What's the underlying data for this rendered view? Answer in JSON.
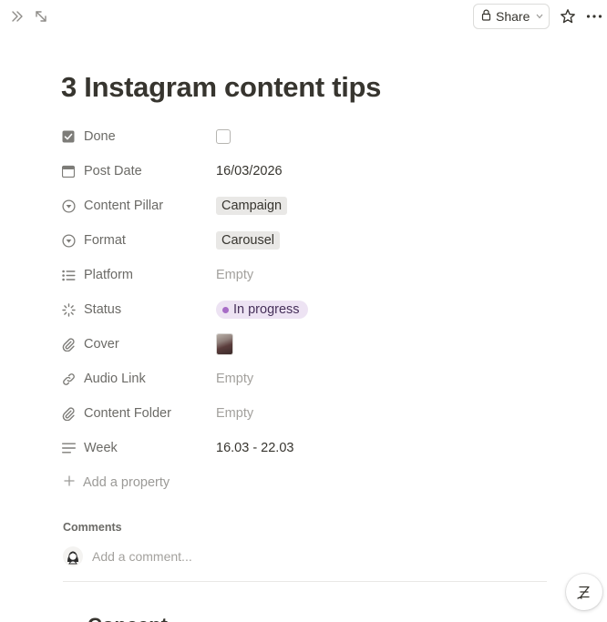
{
  "toolbar": {
    "share_label": "Share"
  },
  "page": {
    "title": "3 Instagram content tips"
  },
  "properties": [
    {
      "name": "Done",
      "icon": "checkbox-icon",
      "value_type": "checkbox",
      "checked": false
    },
    {
      "name": "Post Date",
      "icon": "calendar-icon",
      "value": "16/03/2026"
    },
    {
      "name": "Content Pillar",
      "icon": "select-icon",
      "value": "Campaign"
    },
    {
      "name": "Format",
      "icon": "select-icon",
      "value": "Carousel"
    },
    {
      "name": "Platform",
      "icon": "multi-select-icon",
      "value": "Empty"
    },
    {
      "name": "Status",
      "icon": "status-icon",
      "value": "In progress"
    },
    {
      "name": "Cover",
      "icon": "file-link-icon",
      "value_type": "image"
    },
    {
      "name": "Audio Link",
      "icon": "url-link-icon",
      "value": "Empty"
    },
    {
      "name": "Content Folder",
      "icon": "file-link-icon",
      "value": "Empty"
    },
    {
      "name": "Week",
      "icon": "text-icon",
      "value": "16.03 - 22.03"
    }
  ],
  "add_property_label": "Add a property",
  "comments": {
    "label": "Comments",
    "placeholder": "Add a comment..."
  },
  "next_heading": "Concept",
  "colors": {
    "status_bg": "#ede3f3",
    "status_dot": "#a76cc6",
    "tag_bg": "#e9e8e6",
    "text": "#37352f",
    "muted": "#6b6a66"
  }
}
